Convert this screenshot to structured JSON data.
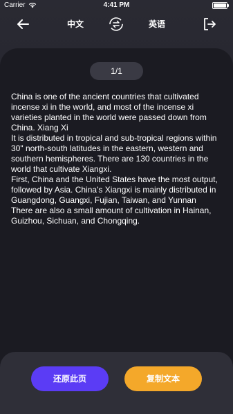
{
  "status_bar": {
    "carrier": "Carrier",
    "time": "4:41 PM",
    "battery_level": 1.0
  },
  "nav": {
    "back_icon": "arrow-left-icon",
    "source_language": "中文",
    "swap_icon": "swap-languages-icon",
    "target_language": "英语",
    "exit_icon": "exit-icon"
  },
  "pager": {
    "label": "1/1"
  },
  "content": {
    "text": "China is one of the ancient countries that cultivated incense xi in the world, and most of the incense xi varieties planted in the world were passed down from China. Xiang Xi\nIt is distributed in tropical and sub-tropical regions within 30\" north-south latitudes in the eastern, western and southern hemispheres. There are 130 countries in the world that cultivate Xiangxi.\nFirst, China and the United States have the most output, followed by Asia. China's Xiangxi is mainly distributed in Guangdong, Guangxi, Fujian, Taiwan, and Yunnan\nThere are also a small amount of cultivation in Hainan, Guizhou, Sichuan, and Chongqing."
  },
  "actions": {
    "restore_label": "还原此页",
    "copy_label": "复制文本"
  },
  "colors": {
    "background": "#222229",
    "card": "#1b1b22",
    "bottom_panel": "#2f2f38",
    "restore_button": "#5b3cf5",
    "copy_button": "#f4a82a"
  }
}
